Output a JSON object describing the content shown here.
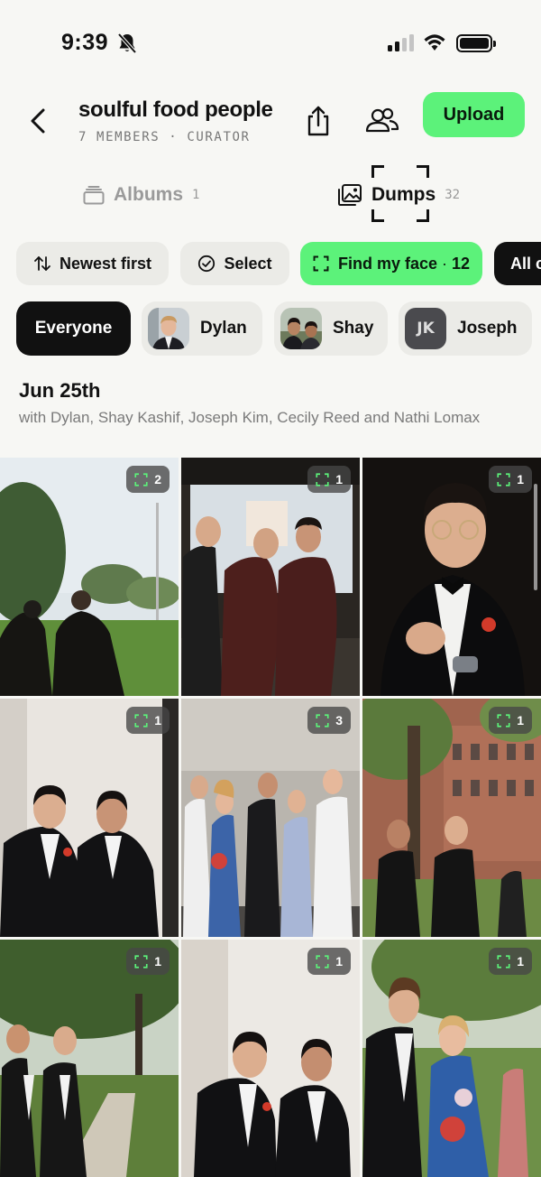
{
  "status_bar": {
    "time": "9:39"
  },
  "header": {
    "title": "soulful food people",
    "subtitle": "7 MEMBERS · CURATOR",
    "upload_label": "Upload"
  },
  "tabs": [
    {
      "label": "Albums",
      "count": "1",
      "icon": "albums-stack-icon"
    },
    {
      "label": "Dumps",
      "count": "32",
      "icon": "photos-icon"
    }
  ],
  "filters": [
    {
      "label": "Newest first",
      "icon": "sort-arrows-icon"
    },
    {
      "label": "Select",
      "icon": "check-circle-icon"
    },
    {
      "label": "Find my face",
      "count": "12",
      "icon": "face-scan-icon"
    },
    {
      "label": "All c"
    }
  ],
  "people": [
    {
      "name": "Everyone"
    },
    {
      "name": "Dylan"
    },
    {
      "name": "Shay"
    },
    {
      "name": "Joseph",
      "initials": "JK"
    }
  ],
  "section": {
    "date": "Jun 25th",
    "with": "with Dylan, Shay Kashif, Joseph Kim, Cecily Reed and Nathi Lomax"
  },
  "photos": [
    {
      "faces": "2"
    },
    {
      "faces": "1"
    },
    {
      "faces": "1"
    },
    {
      "faces": "1"
    },
    {
      "faces": "3"
    },
    {
      "faces": "1"
    },
    {
      "faces": "1"
    },
    {
      "faces": "1"
    },
    {
      "faces": "1"
    }
  ],
  "accent_color": "#5cf27a"
}
